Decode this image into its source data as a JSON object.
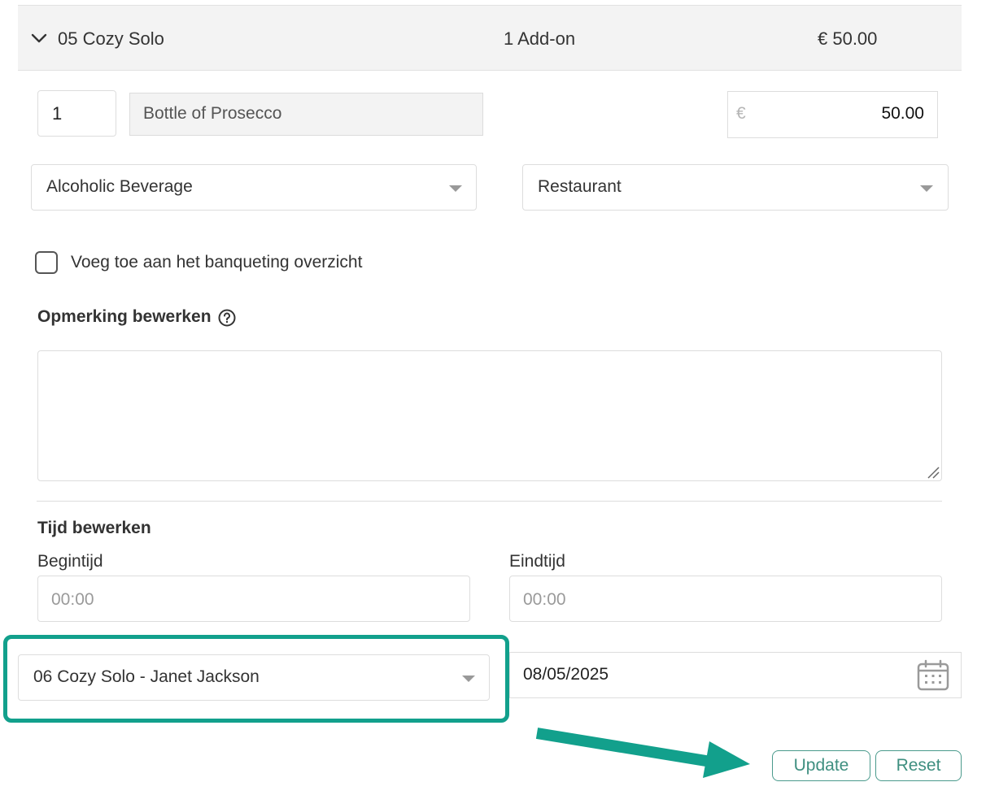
{
  "colors": {
    "accent": "#12a08c",
    "button_text": "#3f8f80",
    "header_bg": "#f3f3f3"
  },
  "line_item": {
    "title": "05 Cozy Solo",
    "addons": "1 Add-on",
    "total": "€ 50.00",
    "expand_icon": "chevron-down-icon"
  },
  "addon": {
    "quantity": "1",
    "name": "Bottle of Prosecco",
    "currency": "€",
    "price": "50.00",
    "category": "Alcoholic Beverage",
    "outlet": "Restaurant"
  },
  "banqueting": {
    "label": "Voeg toe aan het banqueting overzicht",
    "checked": false
  },
  "remark": {
    "title": "Opmerking bewerken",
    "help_icon": "question-circle-icon",
    "value": ""
  },
  "time": {
    "title": "Tijd bewerken",
    "start_label": "Begintijd",
    "start_placeholder": "00:00",
    "end_label": "Eindtijd",
    "end_placeholder": "00:00"
  },
  "booking": {
    "selected": "06 Cozy Solo - Janet Jackson",
    "date": "08/05/2025",
    "calendar_icon": "calendar-icon"
  },
  "actions": {
    "update_label": "Update",
    "reset_label": "Reset"
  }
}
